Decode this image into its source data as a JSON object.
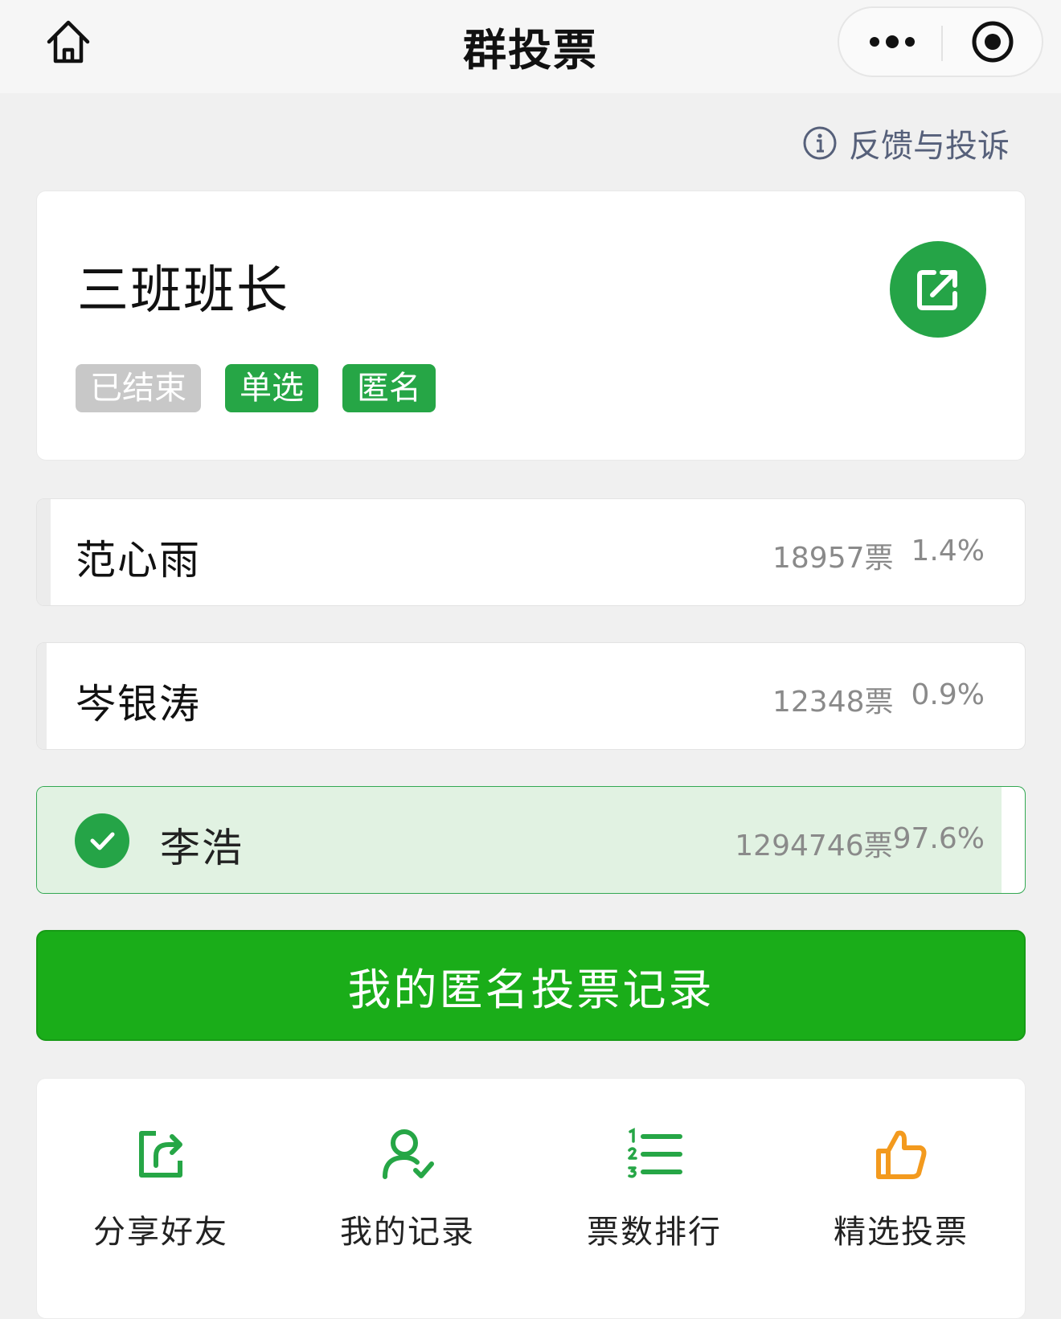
{
  "navbar": {
    "title": "群投票",
    "home_icon": "home-icon",
    "more_icon": "more-dots-icon",
    "close_icon": "target-close-icon"
  },
  "feedback": {
    "label": "反馈与投诉",
    "icon": "info-icon"
  },
  "vote": {
    "title": "三班班长",
    "share_icon": "external-share-icon",
    "tags": [
      {
        "label": "已结束",
        "color": "#c8c8c8"
      },
      {
        "label": "单选",
        "color": "#26a646"
      },
      {
        "label": "匿名",
        "color": "#26a646"
      }
    ]
  },
  "options": [
    {
      "name": "范心雨",
      "votes": "18957票",
      "percent": "1.4%",
      "share": 0.014,
      "selected": false
    },
    {
      "name": "岑银涛",
      "votes": "12348票",
      "percent": "0.9%",
      "share": 0.009,
      "selected": false
    },
    {
      "name": "李浩",
      "votes": "1294746票",
      "percent": "97.6%",
      "share": 0.976,
      "selected": true
    }
  ],
  "primary_button": {
    "label": "我的匿名投票记录",
    "color": "#1aad19"
  },
  "quick_actions": [
    {
      "label": "分享好友",
      "icon": "share-icon",
      "color": "#26a646"
    },
    {
      "label": "我的记录",
      "icon": "user-check-icon",
      "color": "#26a646"
    },
    {
      "label": "票数排行",
      "icon": "ranking-list-icon",
      "color": "#26a646"
    },
    {
      "label": "精选投票",
      "icon": "thumbs-up-icon",
      "color": "#f39a1e"
    }
  ]
}
